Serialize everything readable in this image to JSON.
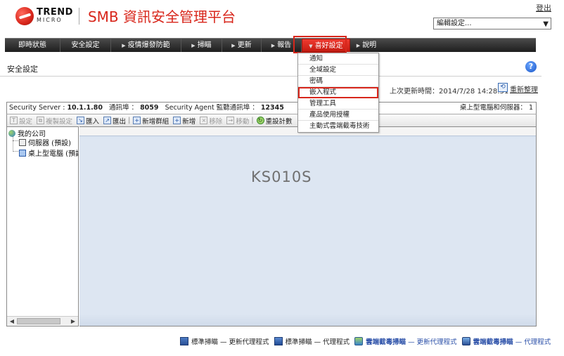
{
  "header": {
    "logout": "登出",
    "logo_line1": "TREND",
    "logo_line2": "MICRO",
    "product_title": "SMB 資訊安全管理平台",
    "edit_select_value": "編輯設定..."
  },
  "nav": {
    "items": [
      {
        "label": "即時狀態",
        "has_arrow": false
      },
      {
        "label": "安全設定",
        "has_arrow": false
      },
      {
        "label": "疫情爆發防範",
        "has_arrow": true
      },
      {
        "label": "掃瞄",
        "has_arrow": true
      },
      {
        "label": "更新",
        "has_arrow": true
      },
      {
        "label": "報告",
        "has_arrow": true
      },
      {
        "label": "喜好設定",
        "has_arrow": true,
        "active": true
      },
      {
        "label": "說明",
        "has_arrow": true
      }
    ]
  },
  "dropdown": {
    "items": [
      "通知",
      "全域設定",
      "密碼",
      "嵌入程式",
      "管理工具",
      "產品使用授權",
      "主動式雲端截毒技術"
    ],
    "selected": "嵌入程式"
  },
  "page": {
    "title": "安全設定",
    "last_update_label": "上次更新時間：",
    "last_update_value": "2014/7/28 14:28:51",
    "refresh_label": "重新整理"
  },
  "infobar": {
    "server_label": "Security Server :",
    "server_value": "10.1.1.80",
    "port_label": "通訊埠 ：",
    "port_value": "8059",
    "agent_port_label": "Security Agent 監聽通訊埠 ：",
    "agent_port_value": "12345",
    "right_text": "桌上型電腦和伺服器： 1"
  },
  "toolbar": {
    "settings": "設定",
    "copy_settings": "複製設定",
    "import": "匯入",
    "export": "匯出",
    "add_group": "新增群組",
    "add": "新增",
    "remove": "移除",
    "move": "移動",
    "reset_counter": "重設計數"
  },
  "tree": {
    "root": "我的公司",
    "servers": "伺服器 (預設)",
    "desktops": "桌上型電腦 (預設"
  },
  "watermark": "KS010S",
  "legend": {
    "item1": "標準掃瞄 — 更新代理程式",
    "item2": "標準掃瞄 — 代理程式",
    "item3_bold": "雲端截毒掃瞄",
    "item3_rest": " — 更新代理程式",
    "item4_bold": "雲端截毒掃瞄",
    "item4_rest": " — 代理程式"
  },
  "colors": {
    "brand_red": "#d8261b",
    "nav_dark": "#2a2a2a",
    "link_blue": "#2a4fa8"
  }
}
